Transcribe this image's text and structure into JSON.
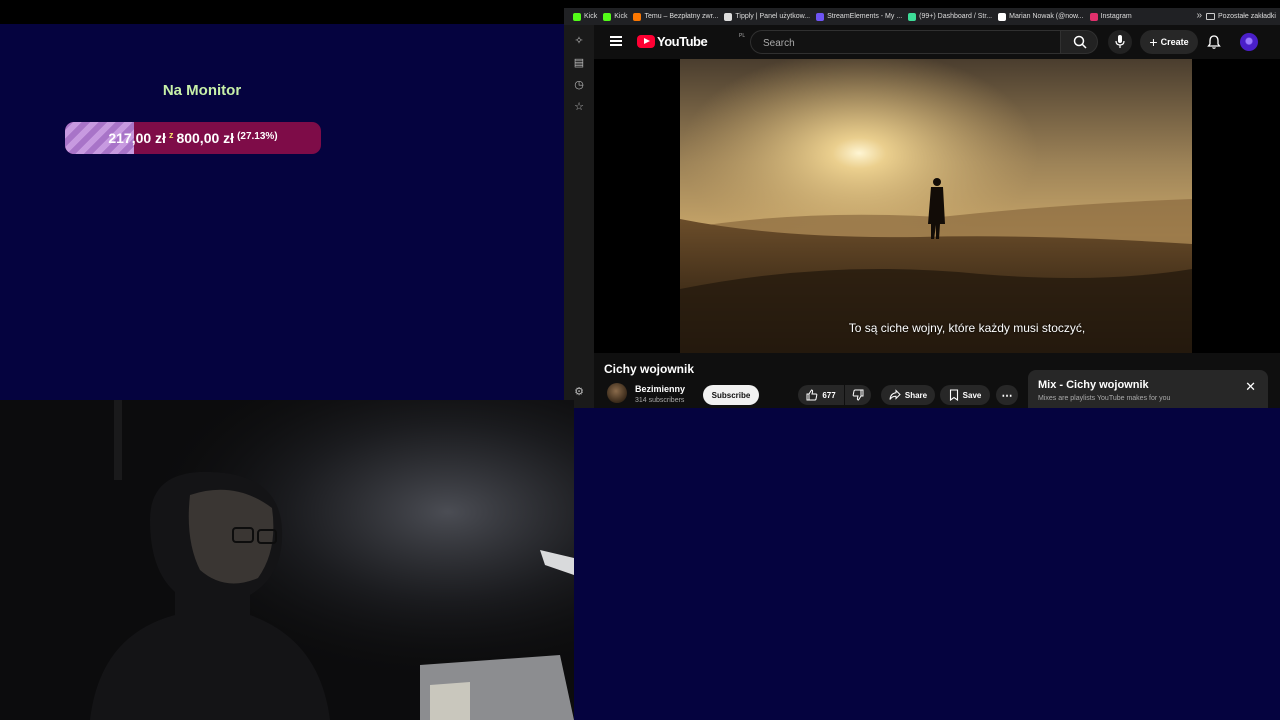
{
  "goal": {
    "title": "Na Monitor",
    "current": "217,00 zł",
    "of": "z",
    "target": "800,00 zł",
    "percent_text": "(27.13%)",
    "progress_fraction": 0.2713
  },
  "bookmarks": [
    {
      "label": "Kick",
      "color": "#53fc18"
    },
    {
      "label": "Kick",
      "color": "#53fc18"
    },
    {
      "label": "Temu – Bezpłatny zwr...",
      "color": "#fb7701"
    },
    {
      "label": "Tipply | Panel użytkow...",
      "color": "#dddddd"
    },
    {
      "label": "StreamElements - My ...",
      "color": "#6e54f3"
    },
    {
      "label": "(99+) Dashboard / Str...",
      "color": "#3ddc97"
    },
    {
      "label": "Marian Nowak (@now...",
      "color": "#ffffff"
    },
    {
      "label": "Instagram",
      "color": "#e1306c"
    }
  ],
  "bookmarks_more": "»",
  "bookmarks_other": "Pozostałe zakładki",
  "youtube": {
    "logo_text": "YouTube",
    "country": "PL",
    "search_placeholder": "Search",
    "create_label": "Create",
    "subtitle": "To są ciche wojny, które każdy musi stoczyć,",
    "video_title": "Cichy wojownik",
    "channel_name": "Bezimienny",
    "channel_subs": "314 subscribers",
    "subscribe_label": "Subscribe",
    "likes": "677",
    "share_label": "Share",
    "save_label": "Save",
    "more_label": "⋯",
    "mix_title": "Mix - Cichy wojownik",
    "mix_subtitle": "Mixes are playlists YouTube makes for you",
    "close_label": "✕"
  }
}
